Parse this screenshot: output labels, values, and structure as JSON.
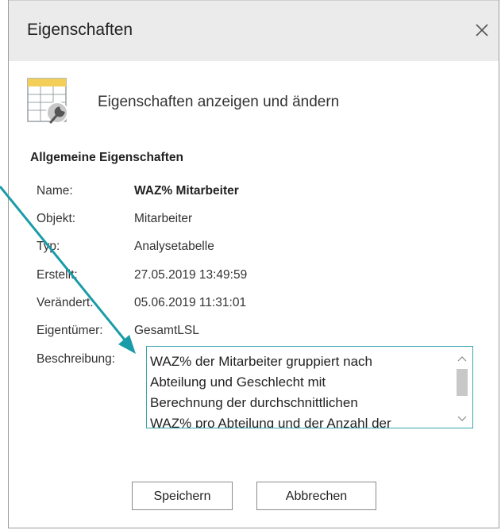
{
  "dialog": {
    "title": "Eigenschaften",
    "close_glyph": "×",
    "header_text": "Eigenschaften anzeigen und ändern",
    "header_icon": "table-settings-icon",
    "section_title": "Allgemeine Eigenschaften"
  },
  "properties": {
    "name": {
      "label": "Name:",
      "value": "WAZ% Mitarbeiter"
    },
    "object": {
      "label": "Objekt:",
      "value": "Mitarbeiter"
    },
    "type": {
      "label": "Typ:",
      "value": "Analysetabelle"
    },
    "created": {
      "label": "Erstellt:",
      "value": "27.05.2019 13:49:59"
    },
    "modified": {
      "label": "Verändert:",
      "value": "05.06.2019 11:31:01"
    },
    "owner": {
      "label": "Eigentümer:",
      "value": "GesamtLSL"
    },
    "description": {
      "label": "Beschreibung:",
      "lines": [
        "WAZ% der Mitarbeiter gruppiert nach",
        "Abteilung und Geschlecht mit",
        "Berechnung der durchschnittlichen",
        "WAZ% pro Abteilung und der Anzahl der"
      ]
    }
  },
  "buttons": {
    "save": "Speichern",
    "cancel": "Abbrechen"
  },
  "colors": {
    "accent": "#1a9ca8",
    "titlebar": "#ebebeb",
    "focus_border": "#3aa4b0"
  }
}
